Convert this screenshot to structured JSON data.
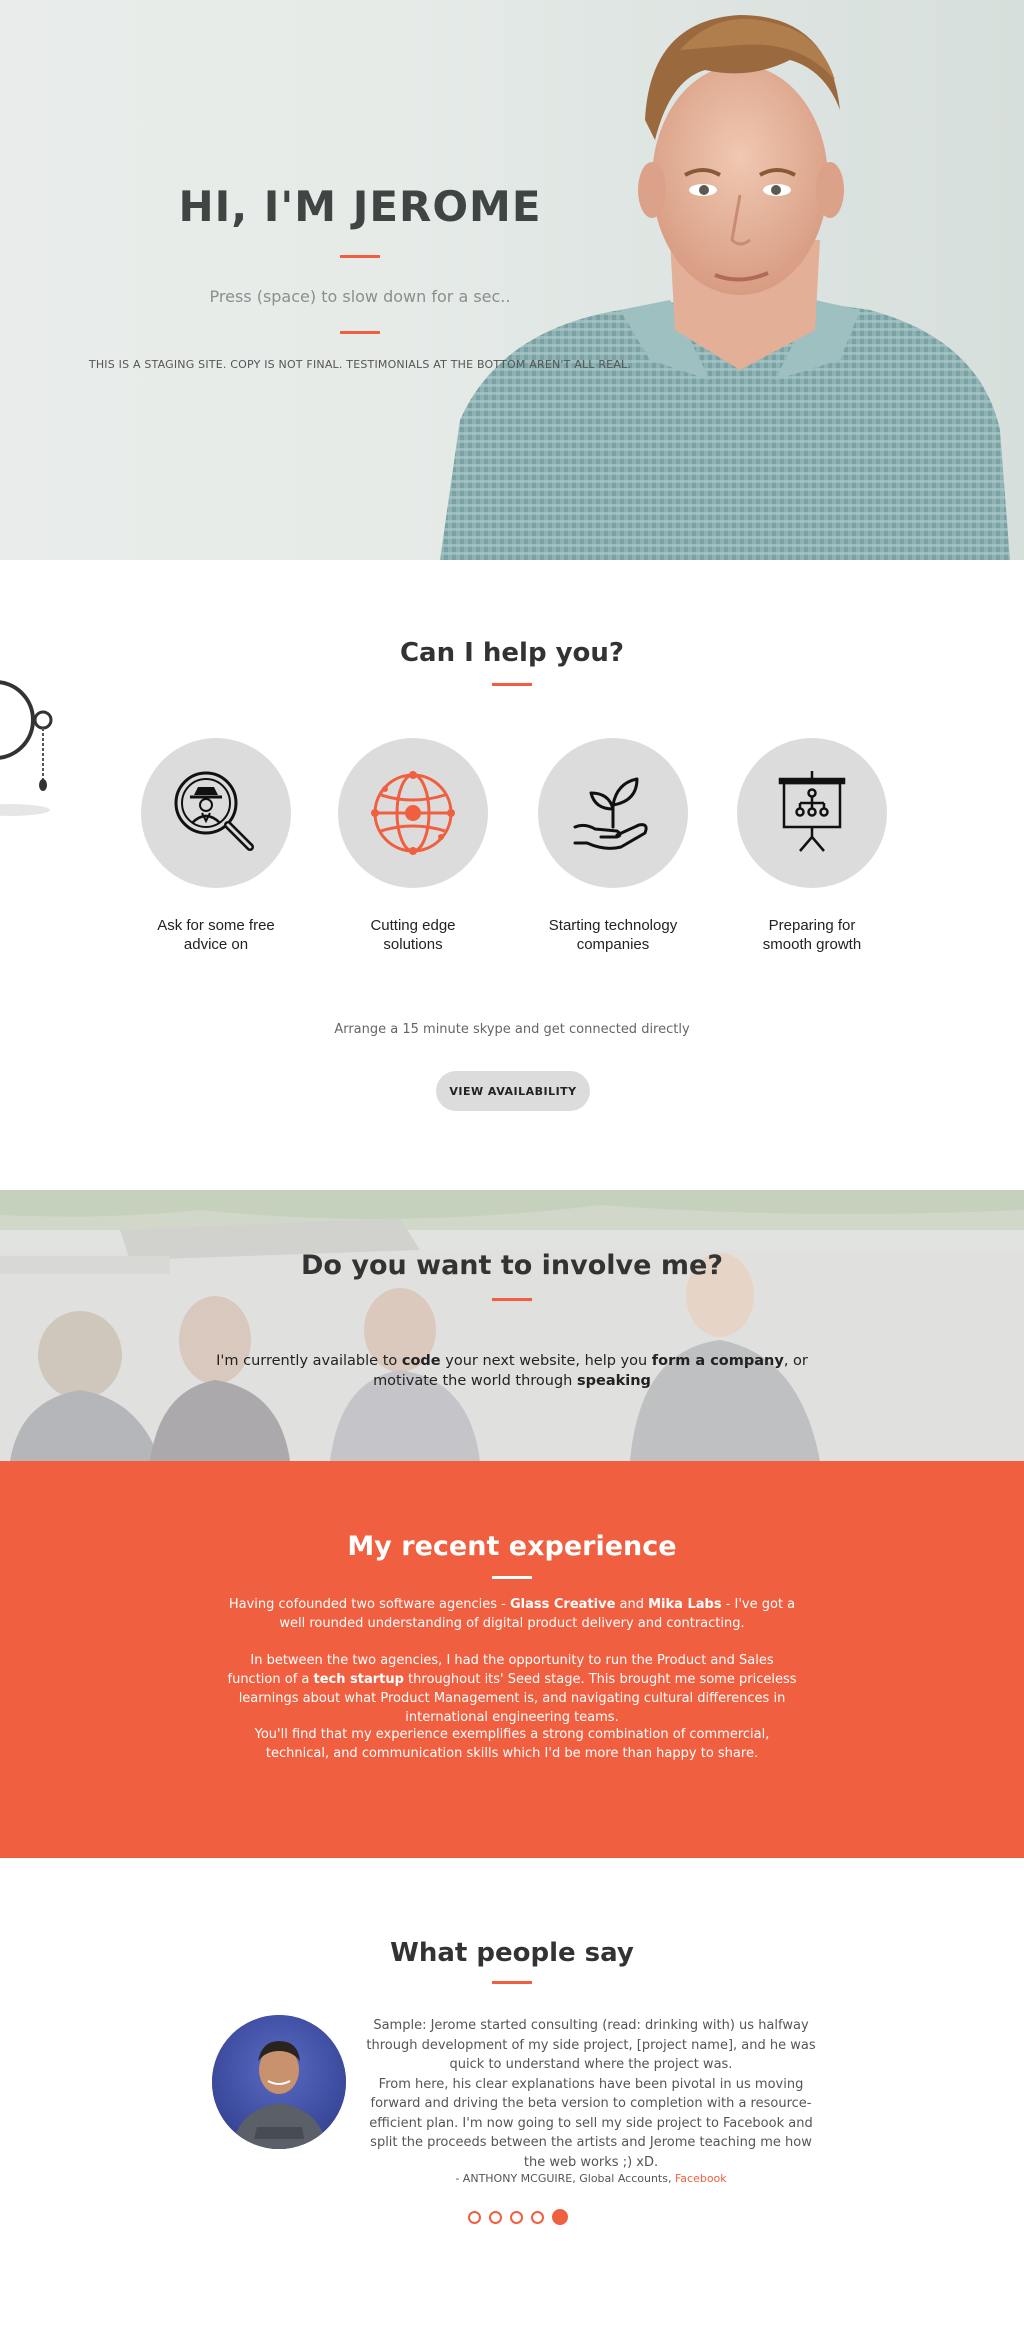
{
  "hero": {
    "title": "HI, I'M JEROME",
    "subtitle": "Press (space) to slow down for a sec..",
    "note": "THIS IS A STAGING SITE. COPY IS NOT FINAL. TESTIMONIALS AT THE BOTTOM AREN'T ALL REAL."
  },
  "help": {
    "title": "Can I help you?",
    "services": [
      {
        "label": "Ask for some free advice on",
        "icon": "magnifier-person-icon"
      },
      {
        "label": "Cutting edge solutions",
        "icon": "globe-network-icon"
      },
      {
        "label": "Starting technology companies",
        "icon": "plant-in-hand-icon"
      },
      {
        "label": "Preparing for smooth growth",
        "icon": "presentation-chart-icon"
      }
    ],
    "arrange": "Arrange a 15 minute skype and get connected directly",
    "button": "VIEW AVAILABILITY"
  },
  "involve": {
    "title": "Do you want to involve me?",
    "text_1": "I'm currently available to ",
    "bold_1": "code",
    "text_2": " your next website, help you ",
    "bold_2": "form a company",
    "text_3": ", or motivate the world through ",
    "bold_3": "speaking"
  },
  "experience": {
    "title": "My recent experience",
    "p1_a": "Having cofounded two software agencies - ",
    "p1_b1": "Glass Creative",
    "p1_c": " and ",
    "p1_b2": "Mika Labs",
    "p1_d": " - I've got a well rounded understanding of digital product delivery and contracting.",
    "p2_a": "In between the two agencies, I had the opportunity to run the Product and Sales function of a ",
    "p2_b": "tech startup",
    "p2_c": " throughout its' Seed stage. This brought me some priceless learnings about what Product Management is, and navigating cultural differences in international engineering teams.",
    "p3": "You'll find that my experience exemplifies a strong combination of commercial, technical, and communication skills which I'd be more than happy to share."
  },
  "testimonials": {
    "title": "What people say",
    "quote": "Sample: Jerome started consulting (read: drinking with) us halfway through development of my side project, [project name], and he was quick to understand where the project was.",
    "quote_2": "From here, his clear explanations have been pivotal in us moving forward and driving the beta version to completion with a resource-efficient plan. I'm now going to sell my side project to Facebook and split the proceeds between the artists and Jerome teaching me how the web works ;) xD.",
    "author": "- ANTHONY MCGUIRE, Global Accounts, ",
    "company": "Facebook",
    "active_index": 4,
    "count": 5
  },
  "colors": {
    "accent": "#f05f40",
    "circle": "#dcdcdc"
  }
}
